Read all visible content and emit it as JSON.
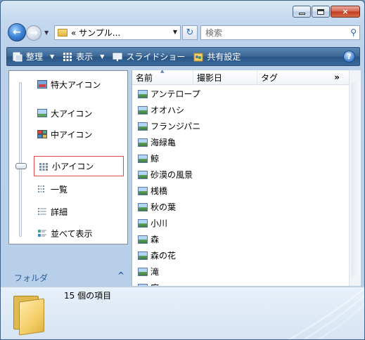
{
  "window": {
    "close_glyph": "×"
  },
  "address_bar": {
    "path_text": "« サンプル..."
  },
  "search": {
    "placeholder": "検索"
  },
  "toolbar": {
    "organize_label": "整理",
    "views_label": "表示",
    "slideshow_label": "スライドショー",
    "share_label": "共有設定",
    "help_label": "?"
  },
  "views_menu": {
    "items": [
      {
        "label": "特大アイコン"
      },
      {
        "label": "大アイコン"
      },
      {
        "label": "中アイコン"
      },
      {
        "label": "小アイコン"
      },
      {
        "label": "一覧"
      },
      {
        "label": "詳細"
      },
      {
        "label": "並べて表示"
      }
    ],
    "selected": "小アイコン"
  },
  "nav_pane": {
    "folders_label": "フォルダ",
    "chevron": "^"
  },
  "columns": {
    "name": "名前",
    "date": "撮影日",
    "tag": "タグ",
    "more": "»"
  },
  "files": [
    {
      "name": "アンテロープ"
    },
    {
      "name": "オオハシ"
    },
    {
      "name": "フランジパニ"
    },
    {
      "name": "海緑亀"
    },
    {
      "name": "鯨"
    },
    {
      "name": "砂漠の風景"
    },
    {
      "name": "桟橋"
    },
    {
      "name": "秋の葉"
    },
    {
      "name": "小川"
    },
    {
      "name": "森"
    },
    {
      "name": "森の花"
    },
    {
      "name": "滝"
    },
    {
      "name": "庭"
    }
  ],
  "status": {
    "item_count": "15 個の項目"
  }
}
